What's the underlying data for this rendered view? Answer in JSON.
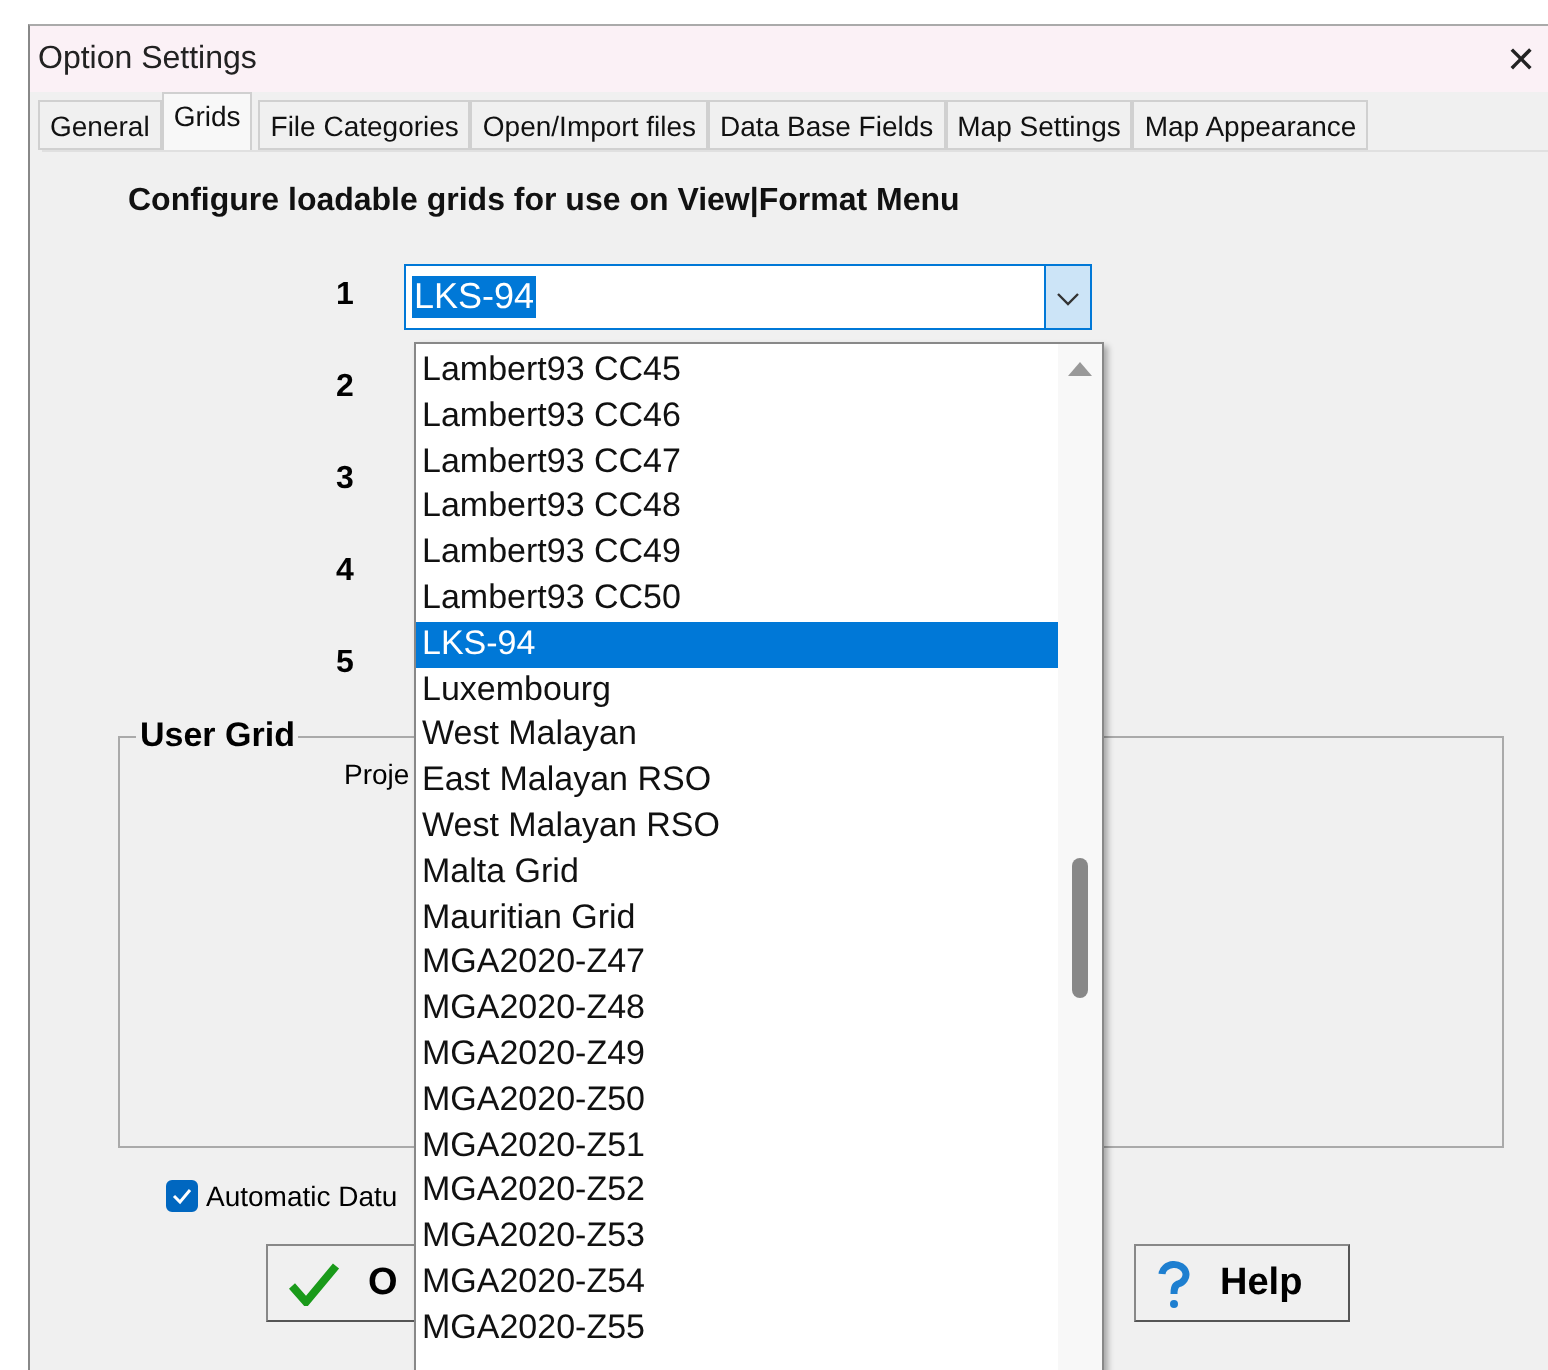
{
  "window": {
    "title": "Option Settings",
    "close": "✕"
  },
  "tabs": [
    {
      "label": "General",
      "selected": false
    },
    {
      "label": "Grids",
      "selected": true
    },
    {
      "label": "File Categories",
      "selected": false
    },
    {
      "label": "Open/Import files",
      "selected": false
    },
    {
      "label": "Data Base Fields",
      "selected": false
    },
    {
      "label": "Map Settings",
      "selected": false
    },
    {
      "label": "Map Appearance",
      "selected": false
    }
  ],
  "heading": "Configure loadable grids  for use on View|Format Menu",
  "grid_rows": [
    {
      "number": "1",
      "value": "LKS-94"
    },
    {
      "number": "2"
    },
    {
      "number": "3"
    },
    {
      "number": "4"
    },
    {
      "number": "5"
    }
  ],
  "dropdown": {
    "items": [
      {
        "label": "Lambert93 CC45",
        "selected": false
      },
      {
        "label": "Lambert93 CC46",
        "selected": false
      },
      {
        "label": "Lambert93 CC47",
        "selected": false
      },
      {
        "label": "Lambert93 CC48",
        "selected": false
      },
      {
        "label": "Lambert93 CC49",
        "selected": false
      },
      {
        "label": "Lambert93 CC50",
        "selected": false
      },
      {
        "label": "LKS-94",
        "selected": true
      },
      {
        "label": "Luxembourg",
        "selected": false
      },
      {
        "label": "West Malayan",
        "selected": false
      },
      {
        "label": "East Malayan RSO",
        "selected": false
      },
      {
        "label": "West Malayan RSO",
        "selected": false
      },
      {
        "label": "Malta Grid",
        "selected": false
      },
      {
        "label": "Mauritian Grid",
        "selected": false
      },
      {
        "label": "MGA2020-Z47",
        "selected": false
      },
      {
        "label": "MGA2020-Z48",
        "selected": false
      },
      {
        "label": "MGA2020-Z49",
        "selected": false
      },
      {
        "label": "MGA2020-Z50",
        "selected": false
      },
      {
        "label": "MGA2020-Z51",
        "selected": false
      },
      {
        "label": "MGA2020-Z52",
        "selected": false
      },
      {
        "label": "MGA2020-Z53",
        "selected": false
      },
      {
        "label": "MGA2020-Z54",
        "selected": false
      },
      {
        "label": "MGA2020-Z55",
        "selected": false
      }
    ]
  },
  "user_grid": {
    "title": "User Grid",
    "label": "Proje"
  },
  "auto_datum": {
    "label": "Automatic Datu",
    "checked": true
  },
  "buttons": [
    {
      "kind": "ok",
      "label": "O"
    },
    {
      "kind": "help",
      "label": "Help"
    }
  ]
}
